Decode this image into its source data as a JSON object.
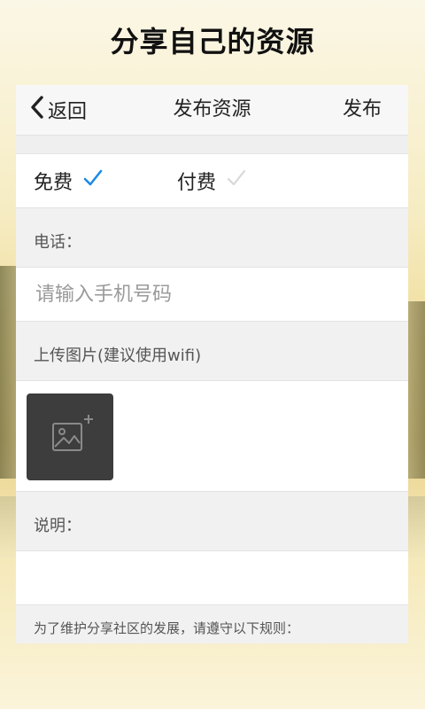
{
  "banner": {
    "title": "分享自己的资源"
  },
  "navbar": {
    "back_label": "返回",
    "title": "发布资源",
    "publish_label": "发布"
  },
  "pricing": {
    "free_label": "免费",
    "paid_label": "付费",
    "selected": "免费"
  },
  "phone": {
    "label": "电话：",
    "placeholder": "请输入手机号码",
    "value": ""
  },
  "upload": {
    "label": "上传图片(建议使用wifi)"
  },
  "description": {
    "label": "说明：",
    "value": ""
  },
  "rules": {
    "text": "为了维护分享社区的发展，请遵守以下规则："
  },
  "colors": {
    "accent": "#1e8ae6",
    "check_inactive": "#d8d8d8",
    "upload_bg": "#3d3d3d"
  },
  "icons": {
    "back": "chevron-left-icon",
    "check": "check-icon",
    "add_image": "add-image-icon"
  }
}
